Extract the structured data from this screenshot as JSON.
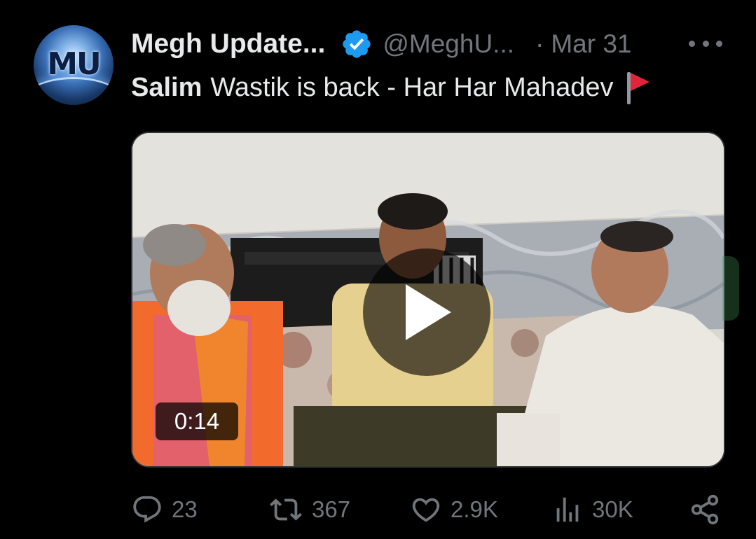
{
  "tweet": {
    "avatar_text": "MU",
    "author_name": "Megh Update...",
    "handle": "@MeghU...",
    "separator": "·",
    "date": "Mar 31",
    "text_bold": "Salim",
    "text_rest": "Wastik is back - Har Har Mahadev",
    "video": {
      "duration": "0:14"
    },
    "stats": {
      "replies": "23",
      "reposts": "367",
      "likes": "2.9K",
      "views": "30K"
    }
  },
  "colors": {
    "background": "#000000",
    "text": "#e7e9ea",
    "muted": "#71767b",
    "verified": "#1d9bf0",
    "border": "#2f3336"
  },
  "icons": [
    "verified-badge-icon",
    "more-icon",
    "red-flag-icon",
    "play-icon",
    "reply-icon",
    "repost-icon",
    "like-icon",
    "views-icon",
    "share-icon"
  ]
}
